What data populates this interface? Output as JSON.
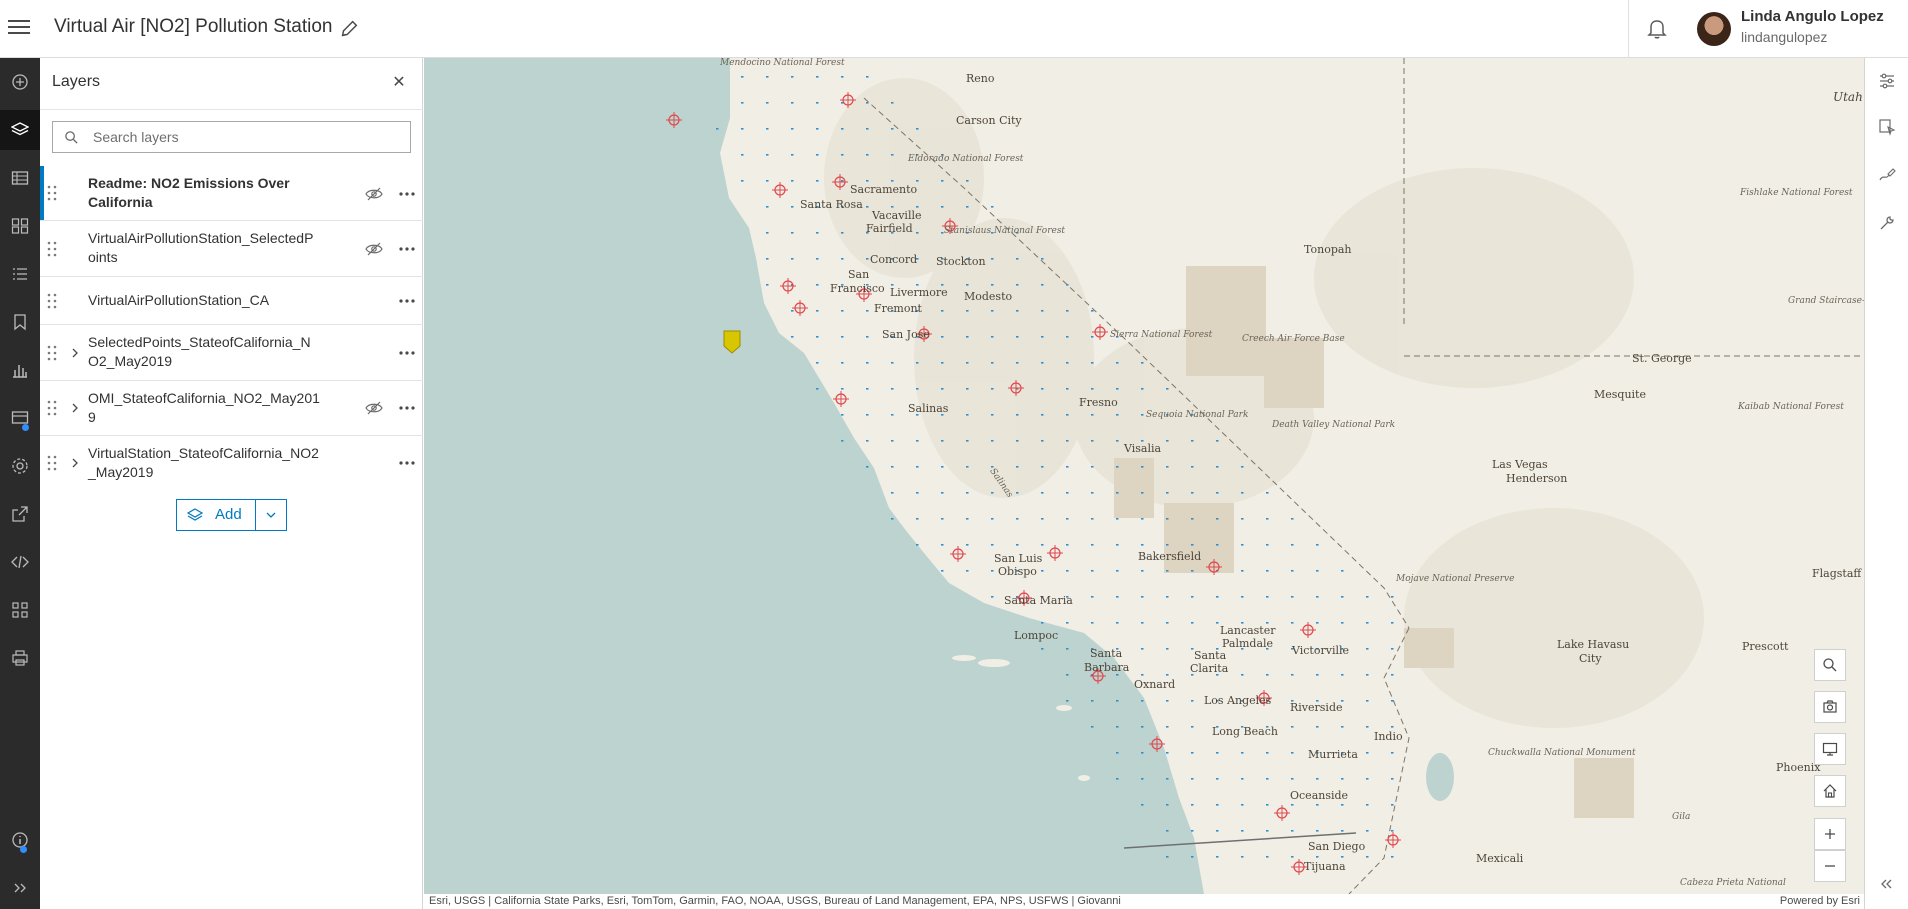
{
  "header": {
    "title": "Virtual Air [NO2] Pollution Station",
    "user_name": "Linda Angulo Lopez",
    "user_login": "lindangulopez"
  },
  "actionbar": {
    "icons": [
      "add-icon",
      "layers-icon",
      "table-icon",
      "basemap-icon",
      "legend-icon",
      "bookmark-icon",
      "charts-icon",
      "tables-icon",
      "properties-icon",
      "share-icon",
      "embed-icon",
      "apps-icon",
      "print-icon",
      "information-icon",
      "expand-icon"
    ]
  },
  "panel": {
    "title": "Layers",
    "search_placeholder": "Search layers",
    "layers": [
      {
        "name": "Readme: NO2 Emissions Over California",
        "expandable": false,
        "hidden": true,
        "selected": true
      },
      {
        "name": "VirtualAirPollutionStation_SelectedPoints",
        "expandable": false,
        "hidden": true,
        "selected": false
      },
      {
        "name": "VirtualAirPollutionStation_CA",
        "expandable": false,
        "hidden": false,
        "selected": false
      },
      {
        "name": "SelectedPoints_StateofCalifornia_NO2_May2019",
        "expandable": true,
        "hidden": false,
        "selected": false
      },
      {
        "name": "OMI_StateofCalifornia_NO2_May2019",
        "expandable": true,
        "hidden": true,
        "selected": false
      },
      {
        "name": "VirtualStation_StateofCalifornia_NO2_May2019",
        "expandable": true,
        "hidden": false,
        "selected": false
      }
    ],
    "add_label": "Add"
  },
  "map": {
    "labels": {
      "mendocino": "Mendocino National Forest",
      "reno": "Reno",
      "carson": "Carson City",
      "utah": "Utah",
      "eldorado": "Eldorado National Forest",
      "sacramento": "Sacramento",
      "santarosa": "Santa Rosa",
      "vacaville": "Vacaville",
      "fairfield": "Fairfield",
      "stanislaus": "Stanislaus National Forest",
      "tonopah": "Tonopah",
      "fishlake": "Fishlake National Forest",
      "concord": "Concord",
      "stockton": "Stockton",
      "sanfrancisco1": "San",
      "sanfrancisco2": "Francisco",
      "livermore": "Livermore",
      "modesto": "Modesto",
      "fremont": "Fremont",
      "grandstaircase": "Grand Staircase-Escalante National Monument",
      "sanjose": "San Jose",
      "sierra": "Sierra National Forest",
      "creechair": "Creech Air Force Base",
      "stgeorge": "St. George",
      "mesquite": "Mesquite",
      "salinas": "Salinas",
      "fresno": "Fresno",
      "sequoia": "Sequoia National Park",
      "deathvalley": "Death Valley National Park",
      "kaibab": "Kaibab National Forest",
      "visalia": "Visalia",
      "lasvegas": "Las Vegas",
      "henderson": "Henderson",
      "salinasriver": "Salinas",
      "sanluis1": "San Luis",
      "sanluis2": "Obispo",
      "bakersfield": "Bakersfield",
      "mojave": "Mojave National Preserve",
      "flagstaff": "Flagstaff",
      "santamaria": "Santa Maria",
      "lompoc": "Lompoc",
      "lancaster": "Lancaster",
      "palmdale": "Palmdale",
      "victorville": "Victorville",
      "lakehavasu1": "Lake Havasu",
      "lakehavasu2": "City",
      "prescott": "Prescott",
      "santabarbara1": "Santa",
      "santabarbara2": "Barbara",
      "santaclarita1": "Santa",
      "santaclarita2": "Clarita",
      "oxnard": "Oxnard",
      "losangeles": "Los Angeles",
      "riverside": "Riverside",
      "longbeach": "Long Beach",
      "indio": "Indio",
      "chuckwalla": "Chuckwalla National Monument",
      "phoenix": "Phoenix",
      "murrieta": "Murrieta",
      "oceanside": "Oceanside",
      "gila": "Gila",
      "sandiego": "San Diego",
      "tijuana": "Tijuana",
      "mexicali": "Mexicali",
      "cabeza": "Cabeza Prieta National"
    },
    "attribution": "Esri, USGS | California State Parks, Esri, TomTom, Garmin, FAO, NOAA, USGS, Bureau of Land Management, EPA, NPS, USFWS | Giovanni",
    "powered_by": "Powered by Esri",
    "controls": [
      "search-icon",
      "screenshot-icon",
      "display-icon",
      "home-icon",
      "zoom-in-icon",
      "zoom-out-icon"
    ],
    "colors": {
      "water": "#bcd3cf",
      "land": "#f1eee6",
      "station": "#e0484d",
      "grid": "#2f8fd0",
      "pin": "#d8c700"
    }
  },
  "rbar": {
    "icons": [
      "properties-icon",
      "styles-icon",
      "sketch-icon",
      "configure-icon",
      "collapse-icon"
    ]
  }
}
